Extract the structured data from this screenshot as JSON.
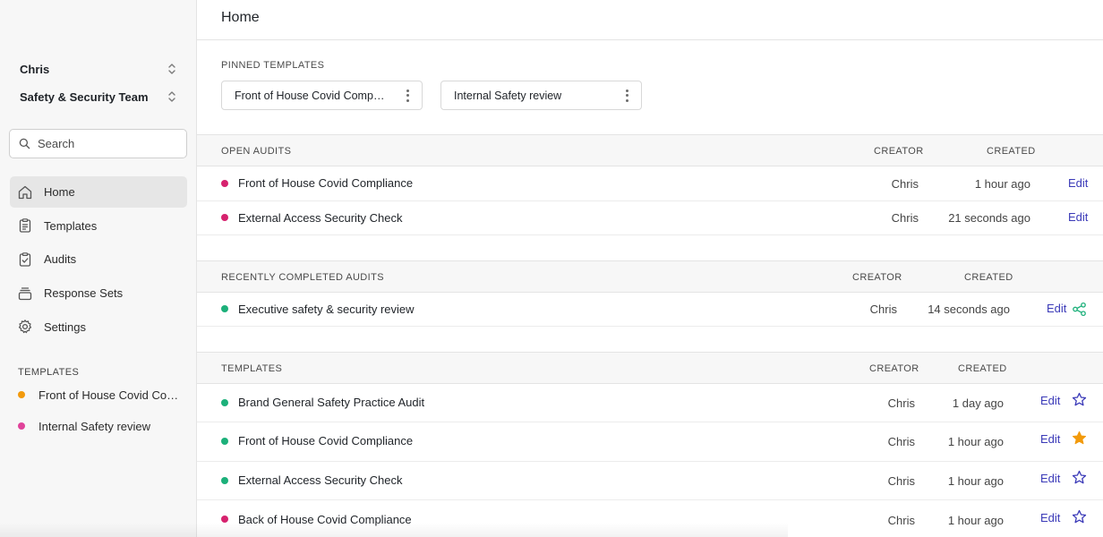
{
  "sidebar": {
    "user": "Chris",
    "team": "Safety & Security Team",
    "search": {
      "placeholder": "Search"
    },
    "nav": [
      {
        "label": "Home",
        "icon": "home-icon",
        "active": true
      },
      {
        "label": "Templates",
        "icon": "clipboard-list-icon"
      },
      {
        "label": "Audits",
        "icon": "clipboard-check-icon"
      },
      {
        "label": "Response Sets",
        "icon": "stack-icon"
      },
      {
        "label": "Settings",
        "icon": "gear-icon"
      }
    ],
    "templates_heading": "TEMPLATES",
    "templates": [
      {
        "label": "Front of House Covid Compliance",
        "color": "#f29a0c"
      },
      {
        "label": "Internal Safety review",
        "color": "#e0439a"
      }
    ]
  },
  "main": {
    "title": "Home",
    "pinned": {
      "label": "PINNED TEMPLATES",
      "items": [
        "Front of House Covid Compliance",
        "Internal Safety review"
      ]
    },
    "open_audits": {
      "label": "OPEN AUDITS",
      "creator_header": "CREATOR",
      "created_header": "CREATED",
      "rows": [
        {
          "name": "Front of House Covid Compliance",
          "creator": "Chris",
          "created": "1 hour ago",
          "action": "Edit",
          "dot": "#d6226e"
        },
        {
          "name": "External Access Security Check",
          "creator": "Chris",
          "created": "21 seconds ago",
          "action": "Edit",
          "dot": "#d6226e"
        }
      ]
    },
    "completed_audits": {
      "label": "RECENTLY COMPLETED AUDITS",
      "creator_header": "CREATOR",
      "created_header": "CREATED",
      "rows": [
        {
          "name": "Executive safety & security review",
          "creator": "Chris",
          "created": "14 seconds ago",
          "action": "Edit",
          "dot": "#1cb07a",
          "icon": "share-icon"
        }
      ]
    },
    "templates": {
      "label": "TEMPLATES",
      "creator_header": "CREATOR",
      "created_header": "CREATED",
      "rows": [
        {
          "name": "Brand General Safety Practice Audit",
          "creator": "Chris",
          "created": "1 day ago",
          "action": "Edit",
          "dot": "#1cb07a",
          "icon": "star-outline-icon"
        },
        {
          "name": "Front of House Covid Compliance",
          "creator": "Chris",
          "created": "1 hour ago",
          "action": "Edit",
          "dot": "#1cb07a",
          "icon": "star-filled-icon"
        },
        {
          "name": "External Access Security Check",
          "creator": "Chris",
          "created": "1 hour ago",
          "action": "Edit",
          "dot": "#1cb07a",
          "icon": "star-outline-icon"
        },
        {
          "name": "Back of House Covid Compliance",
          "creator": "Chris",
          "created": "1 hour ago",
          "action": "Edit",
          "dot": "#d6226e",
          "icon": "star-outline-icon"
        }
      ]
    }
  },
  "colors": {
    "accent": "#3b3ab8",
    "star": "#f29a0c",
    "share": "#1cb07a"
  }
}
